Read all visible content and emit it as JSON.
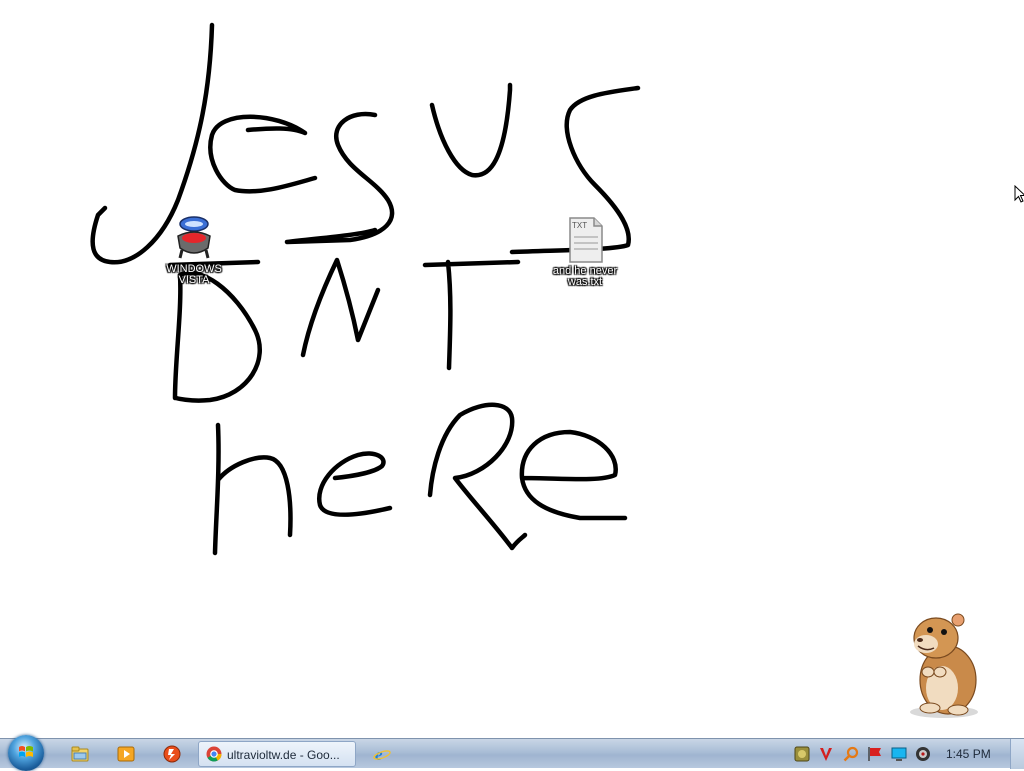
{
  "desktop": {
    "icons": [
      {
        "label": "WINDOWS VISTA"
      },
      {
        "label": "and he never was.txt",
        "badge": "TXT"
      }
    ]
  },
  "taskbar": {
    "start_label": "Start",
    "pinned": [
      {
        "name": "explorer-icon"
      },
      {
        "name": "media-player-icon"
      },
      {
        "name": "flash-app-icon"
      },
      {
        "name": "internet-explorer-icon"
      }
    ],
    "tasks": [
      {
        "label": "ultravioltw.de - Goo...",
        "icon": "chrome-icon"
      }
    ],
    "tray": [
      {
        "name": "tray-app-icon"
      },
      {
        "name": "antivirus-v-icon"
      },
      {
        "name": "search-tray-icon"
      },
      {
        "name": "flag-icon"
      },
      {
        "name": "monitor-icon"
      },
      {
        "name": "audio-icon"
      }
    ],
    "clock": "1:45 PM"
  },
  "colors": {
    "taskbar": "#a9bdd6",
    "desktop": "#ffffff",
    "ink": "#000000"
  }
}
